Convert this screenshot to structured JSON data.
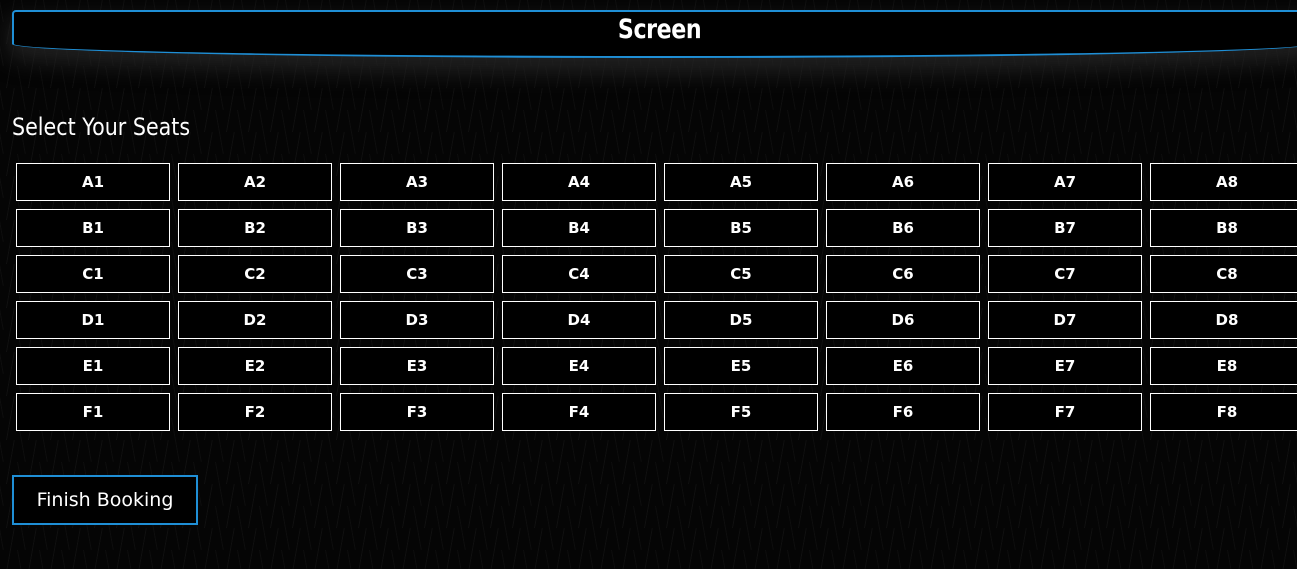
{
  "screen": {
    "title": "Screen",
    "accent_color": "#1f8fd6"
  },
  "seat_selection": {
    "heading": "Select Your Seats",
    "rows": [
      [
        "A1",
        "A2",
        "A3",
        "A4",
        "A5",
        "A6",
        "A7",
        "A8"
      ],
      [
        "B1",
        "B2",
        "B3",
        "B4",
        "B5",
        "B6",
        "B7",
        "B8"
      ],
      [
        "C1",
        "C2",
        "C3",
        "C4",
        "C5",
        "C6",
        "C7",
        "C8"
      ],
      [
        "D1",
        "D2",
        "D3",
        "D4",
        "D5",
        "D6",
        "D7",
        "D8"
      ],
      [
        "E1",
        "E2",
        "E3",
        "E4",
        "E5",
        "E6",
        "E7",
        "E8"
      ],
      [
        "F1",
        "F2",
        "F3",
        "F4",
        "F5",
        "F6",
        "F7",
        "F8"
      ]
    ]
  },
  "actions": {
    "finish_label": "Finish Booking"
  }
}
